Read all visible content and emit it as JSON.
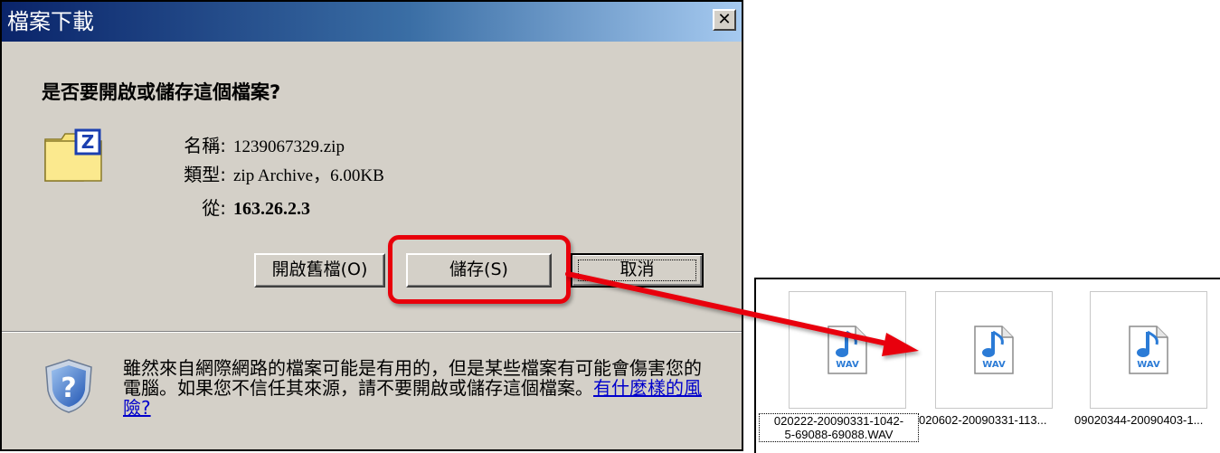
{
  "dialog": {
    "title": "檔案下載",
    "close_symbol": "✕",
    "question": "是否要開啟或儲存這個檔案?",
    "file_icon": "zip-folder-icon",
    "info": {
      "name_label": "名稱:",
      "name_value": "1239067329.zip",
      "type_label": "類型:",
      "type_value": "zip Archive，6.00KB",
      "from_label": "從:",
      "from_value": "163.26.2.3"
    },
    "buttons": {
      "open": "開啟舊檔(O)",
      "save": "儲存(S)",
      "cancel": "取消"
    },
    "warning": {
      "text": "雖然來自網際網路的檔案可能是有用的，但是某些檔案有可能會傷害您的電腦。如果您不信任其來源，請不要開啟或儲存這個檔案。",
      "link": "有什麼樣的風險?"
    },
    "shield_icon": "security-shield-question-icon"
  },
  "annotation": {
    "highlight_color": "#e8000b",
    "arrow_icon": "red-arrow"
  },
  "explorer": {
    "files": [
      {
        "name_line1": "020222-20090331-1042-",
        "name_line2": "5-69088-69088.WAV",
        "icon": "wav-file-icon",
        "icon_label": "WAV"
      },
      {
        "name": "020602-20090331-113...",
        "icon": "wav-file-icon",
        "icon_label": "WAV"
      },
      {
        "name": "09020344-20090403-1...",
        "icon": "wav-file-icon",
        "icon_label": "WAV"
      }
    ]
  },
  "colors": {
    "dialog_bg": "#d4d0c8",
    "title_start": "#0a246a",
    "title_end": "#a6caf0",
    "link": "#0000cc",
    "note_blue": "#2b7bd6"
  }
}
